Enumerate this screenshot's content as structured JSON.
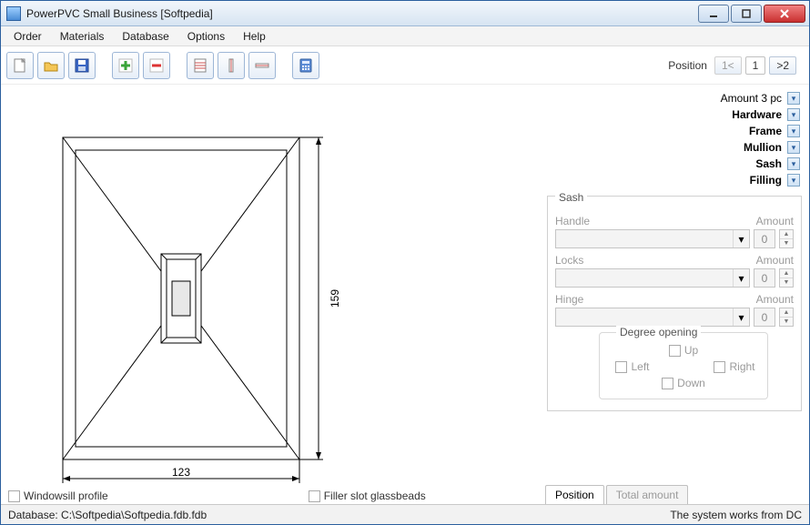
{
  "window": {
    "title": "PowerPVC Small Business [Softpedia]"
  },
  "menu": [
    "Order",
    "Materials",
    "Database",
    "Options",
    "Help"
  ],
  "toolbar_icons": [
    "new",
    "open",
    "save",
    "add",
    "remove",
    "ledger",
    "vruler",
    "hruler",
    "calculator"
  ],
  "position": {
    "label": "Position",
    "prev": "1<",
    "current": "1",
    "next": ">2"
  },
  "properties": {
    "amount": {
      "label": "Amount",
      "value": "3 pc"
    },
    "items": [
      "Hardware",
      "Frame",
      "Mullion",
      "Sash",
      "Filling"
    ]
  },
  "sash_section": {
    "title": "Sash",
    "rows": [
      {
        "label": "Handle",
        "amount_label": "Amount",
        "value": "0"
      },
      {
        "label": "Locks",
        "amount_label": "Amount",
        "value": "0"
      },
      {
        "label": "Hinge",
        "amount_label": "Amount",
        "value": "0"
      }
    ]
  },
  "degree": {
    "title": "Degree opening",
    "up": "Up",
    "down": "Down",
    "left": "Left",
    "right": "Right"
  },
  "tabs": {
    "position": "Position",
    "total": "Total amount"
  },
  "lower": {
    "windowsill": "Windowsill profile",
    "filler": "Filler slot glassbeads"
  },
  "drawing": {
    "width_dim": "123",
    "height_dim": "159"
  },
  "status": {
    "left": "Database: C:\\Softpedia\\Softpedia.fdb.fdb",
    "right": "The system works from DC"
  }
}
